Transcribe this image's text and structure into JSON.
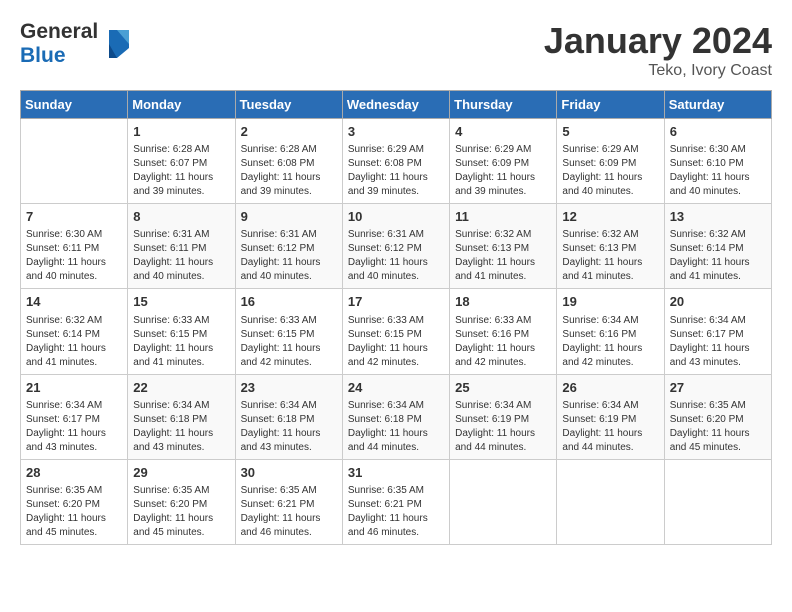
{
  "header": {
    "logo_line1": "General",
    "logo_line2": "Blue",
    "month": "January 2024",
    "location": "Teko, Ivory Coast"
  },
  "weekdays": [
    "Sunday",
    "Monday",
    "Tuesday",
    "Wednesday",
    "Thursday",
    "Friday",
    "Saturday"
  ],
  "weeks": [
    [
      {
        "day": "",
        "sunrise": "",
        "sunset": "",
        "daylight": ""
      },
      {
        "day": "1",
        "sunrise": "6:28 AM",
        "sunset": "6:07 PM",
        "daylight": "11 hours and 39 minutes."
      },
      {
        "day": "2",
        "sunrise": "6:28 AM",
        "sunset": "6:08 PM",
        "daylight": "11 hours and 39 minutes."
      },
      {
        "day": "3",
        "sunrise": "6:29 AM",
        "sunset": "6:08 PM",
        "daylight": "11 hours and 39 minutes."
      },
      {
        "day": "4",
        "sunrise": "6:29 AM",
        "sunset": "6:09 PM",
        "daylight": "11 hours and 39 minutes."
      },
      {
        "day": "5",
        "sunrise": "6:29 AM",
        "sunset": "6:09 PM",
        "daylight": "11 hours and 40 minutes."
      },
      {
        "day": "6",
        "sunrise": "6:30 AM",
        "sunset": "6:10 PM",
        "daylight": "11 hours and 40 minutes."
      }
    ],
    [
      {
        "day": "7",
        "sunrise": "6:30 AM",
        "sunset": "6:11 PM",
        "daylight": "11 hours and 40 minutes."
      },
      {
        "day": "8",
        "sunrise": "6:31 AM",
        "sunset": "6:11 PM",
        "daylight": "11 hours and 40 minutes."
      },
      {
        "day": "9",
        "sunrise": "6:31 AM",
        "sunset": "6:12 PM",
        "daylight": "11 hours and 40 minutes."
      },
      {
        "day": "10",
        "sunrise": "6:31 AM",
        "sunset": "6:12 PM",
        "daylight": "11 hours and 40 minutes."
      },
      {
        "day": "11",
        "sunrise": "6:32 AM",
        "sunset": "6:13 PM",
        "daylight": "11 hours and 41 minutes."
      },
      {
        "day": "12",
        "sunrise": "6:32 AM",
        "sunset": "6:13 PM",
        "daylight": "11 hours and 41 minutes."
      },
      {
        "day": "13",
        "sunrise": "6:32 AM",
        "sunset": "6:14 PM",
        "daylight": "11 hours and 41 minutes."
      }
    ],
    [
      {
        "day": "14",
        "sunrise": "6:32 AM",
        "sunset": "6:14 PM",
        "daylight": "11 hours and 41 minutes."
      },
      {
        "day": "15",
        "sunrise": "6:33 AM",
        "sunset": "6:15 PM",
        "daylight": "11 hours and 41 minutes."
      },
      {
        "day": "16",
        "sunrise": "6:33 AM",
        "sunset": "6:15 PM",
        "daylight": "11 hours and 42 minutes."
      },
      {
        "day": "17",
        "sunrise": "6:33 AM",
        "sunset": "6:15 PM",
        "daylight": "11 hours and 42 minutes."
      },
      {
        "day": "18",
        "sunrise": "6:33 AM",
        "sunset": "6:16 PM",
        "daylight": "11 hours and 42 minutes."
      },
      {
        "day": "19",
        "sunrise": "6:34 AM",
        "sunset": "6:16 PM",
        "daylight": "11 hours and 42 minutes."
      },
      {
        "day": "20",
        "sunrise": "6:34 AM",
        "sunset": "6:17 PM",
        "daylight": "11 hours and 43 minutes."
      }
    ],
    [
      {
        "day": "21",
        "sunrise": "6:34 AM",
        "sunset": "6:17 PM",
        "daylight": "11 hours and 43 minutes."
      },
      {
        "day": "22",
        "sunrise": "6:34 AM",
        "sunset": "6:18 PM",
        "daylight": "11 hours and 43 minutes."
      },
      {
        "day": "23",
        "sunrise": "6:34 AM",
        "sunset": "6:18 PM",
        "daylight": "11 hours and 43 minutes."
      },
      {
        "day": "24",
        "sunrise": "6:34 AM",
        "sunset": "6:18 PM",
        "daylight": "11 hours and 44 minutes."
      },
      {
        "day": "25",
        "sunrise": "6:34 AM",
        "sunset": "6:19 PM",
        "daylight": "11 hours and 44 minutes."
      },
      {
        "day": "26",
        "sunrise": "6:34 AM",
        "sunset": "6:19 PM",
        "daylight": "11 hours and 44 minutes."
      },
      {
        "day": "27",
        "sunrise": "6:35 AM",
        "sunset": "6:20 PM",
        "daylight": "11 hours and 45 minutes."
      }
    ],
    [
      {
        "day": "28",
        "sunrise": "6:35 AM",
        "sunset": "6:20 PM",
        "daylight": "11 hours and 45 minutes."
      },
      {
        "day": "29",
        "sunrise": "6:35 AM",
        "sunset": "6:20 PM",
        "daylight": "11 hours and 45 minutes."
      },
      {
        "day": "30",
        "sunrise": "6:35 AM",
        "sunset": "6:21 PM",
        "daylight": "11 hours and 46 minutes."
      },
      {
        "day": "31",
        "sunrise": "6:35 AM",
        "sunset": "6:21 PM",
        "daylight": "11 hours and 46 minutes."
      },
      {
        "day": "",
        "sunrise": "",
        "sunset": "",
        "daylight": ""
      },
      {
        "day": "",
        "sunrise": "",
        "sunset": "",
        "daylight": ""
      },
      {
        "day": "",
        "sunrise": "",
        "sunset": "",
        "daylight": ""
      }
    ]
  ]
}
